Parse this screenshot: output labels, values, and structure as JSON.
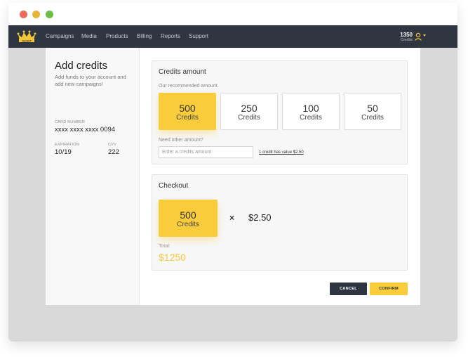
{
  "nav": {
    "items": [
      "Campaigns",
      "Media",
      "Products",
      "Billing",
      "Reports",
      "Support"
    ],
    "credits_value": "1350",
    "credits_label": "Credits",
    "logo_text": "TaCHUT",
    "accent": "#f5c83a",
    "bg": "#2f3541"
  },
  "sidebar": {
    "title": "Add credits",
    "subtitle": "Add funds to your account and add new campaigns!",
    "card_number_label": "CARD NUMBER",
    "card_number": "xxxx xxxx xxxx 0094",
    "expiration_label": "EXPIRATION",
    "expiration": "10/19",
    "cvv_label": "CVV",
    "cvv": "222"
  },
  "credits_panel": {
    "title": "Credits amount",
    "recommended_text": "Our recommended amount.",
    "options": [
      {
        "amount": "500",
        "label": "Credits",
        "selected": true
      },
      {
        "amount": "250",
        "label": "Credits",
        "selected": false
      },
      {
        "amount": "100",
        "label": "Credits",
        "selected": false
      },
      {
        "amount": "50",
        "label": "Credits",
        "selected": false
      }
    ],
    "other_amount_text": "Need other amount?",
    "input_placeholder": "Enter a credits amount",
    "credit_value_link": "1 credit has value $2.50"
  },
  "checkout": {
    "title": "Checkout",
    "amount": "500",
    "amount_label": "Credits",
    "times": "×",
    "price": "$2.50",
    "total_label": "Total:",
    "total": "$1250"
  },
  "actions": {
    "cancel": "CANCEL",
    "confirm": "CONFIRM"
  }
}
